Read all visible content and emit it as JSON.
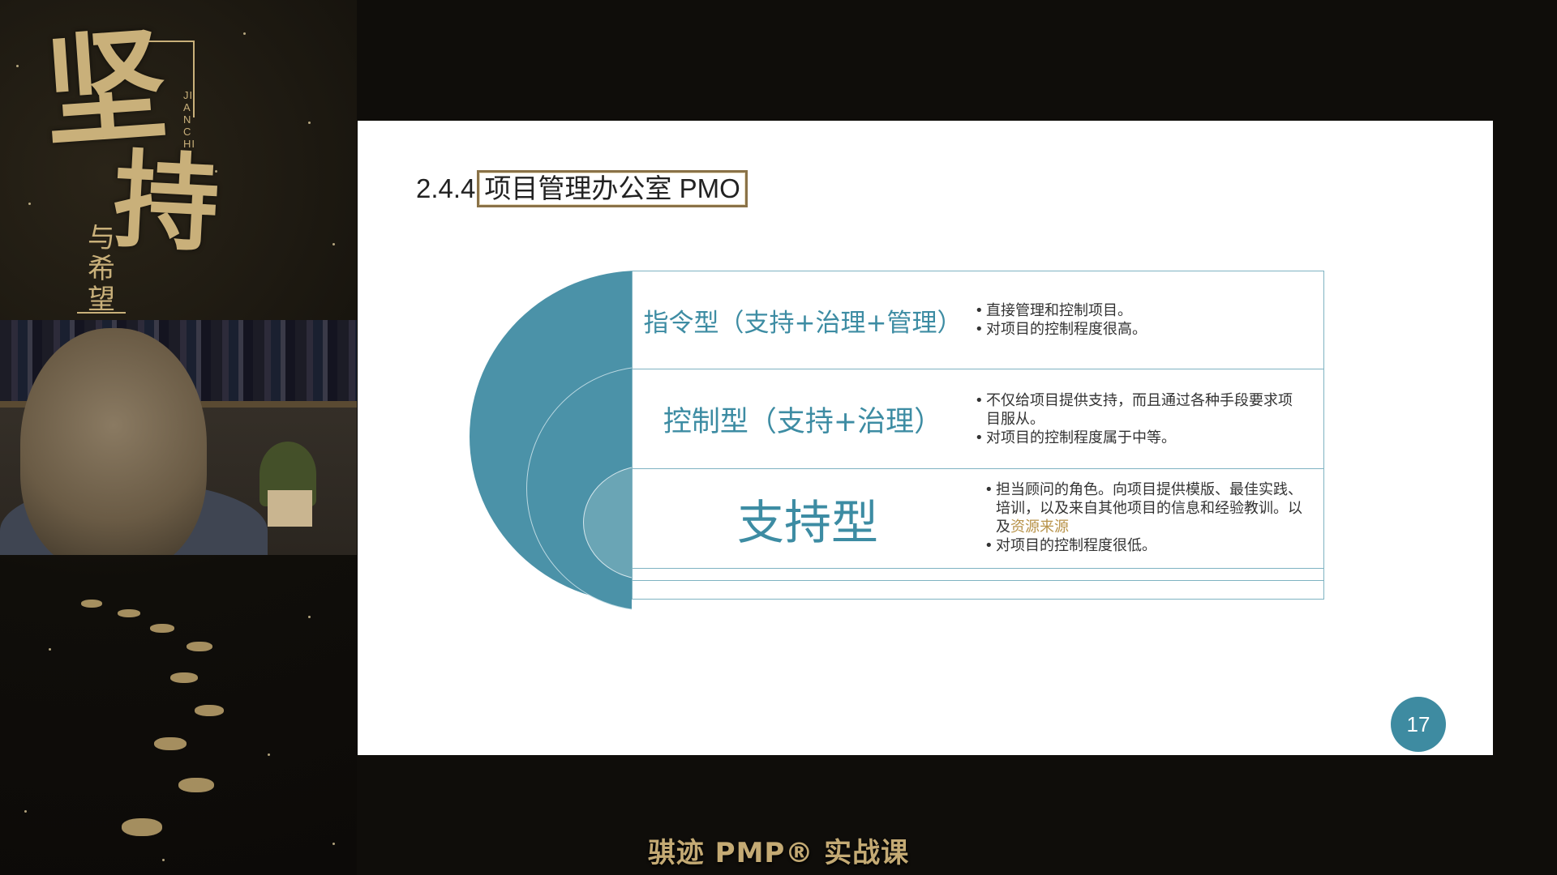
{
  "left_panel": {
    "calligraphy_main_1": "坚",
    "calligraphy_main_2": "持",
    "calligraphy_sub": "与希望",
    "pinyin": "JIANCHI"
  },
  "slide": {
    "title_number": "2.4.4",
    "title_text": "项目管理办公室 PMO",
    "rows": [
      {
        "title": "指令型（支持+治理+管理）",
        "bullets": [
          "直接管理和控制项目。",
          "对项目的控制程度很高。"
        ]
      },
      {
        "title": "控制型（支持+治理）",
        "bullets": [
          "不仅给项目提供支持，而且通过各种手段要求项目服从。",
          "对项目的控制程度属于中等。"
        ]
      },
      {
        "title": "支持型",
        "bullet1_pre": "担当顾问的角色。向项目提供模版、最佳实践、培训，以及来自其他项目的信息和经验教训。以及",
        "bullet1_hl": "资源来源",
        "bullet2": "对项目的控制程度很低。"
      }
    ],
    "page_number": "17"
  },
  "caption": "骐迹 PMP® 实战课",
  "colors": {
    "accent": "#4b92a8",
    "gold": "#c4aa74",
    "highlight": "#b8934a"
  }
}
